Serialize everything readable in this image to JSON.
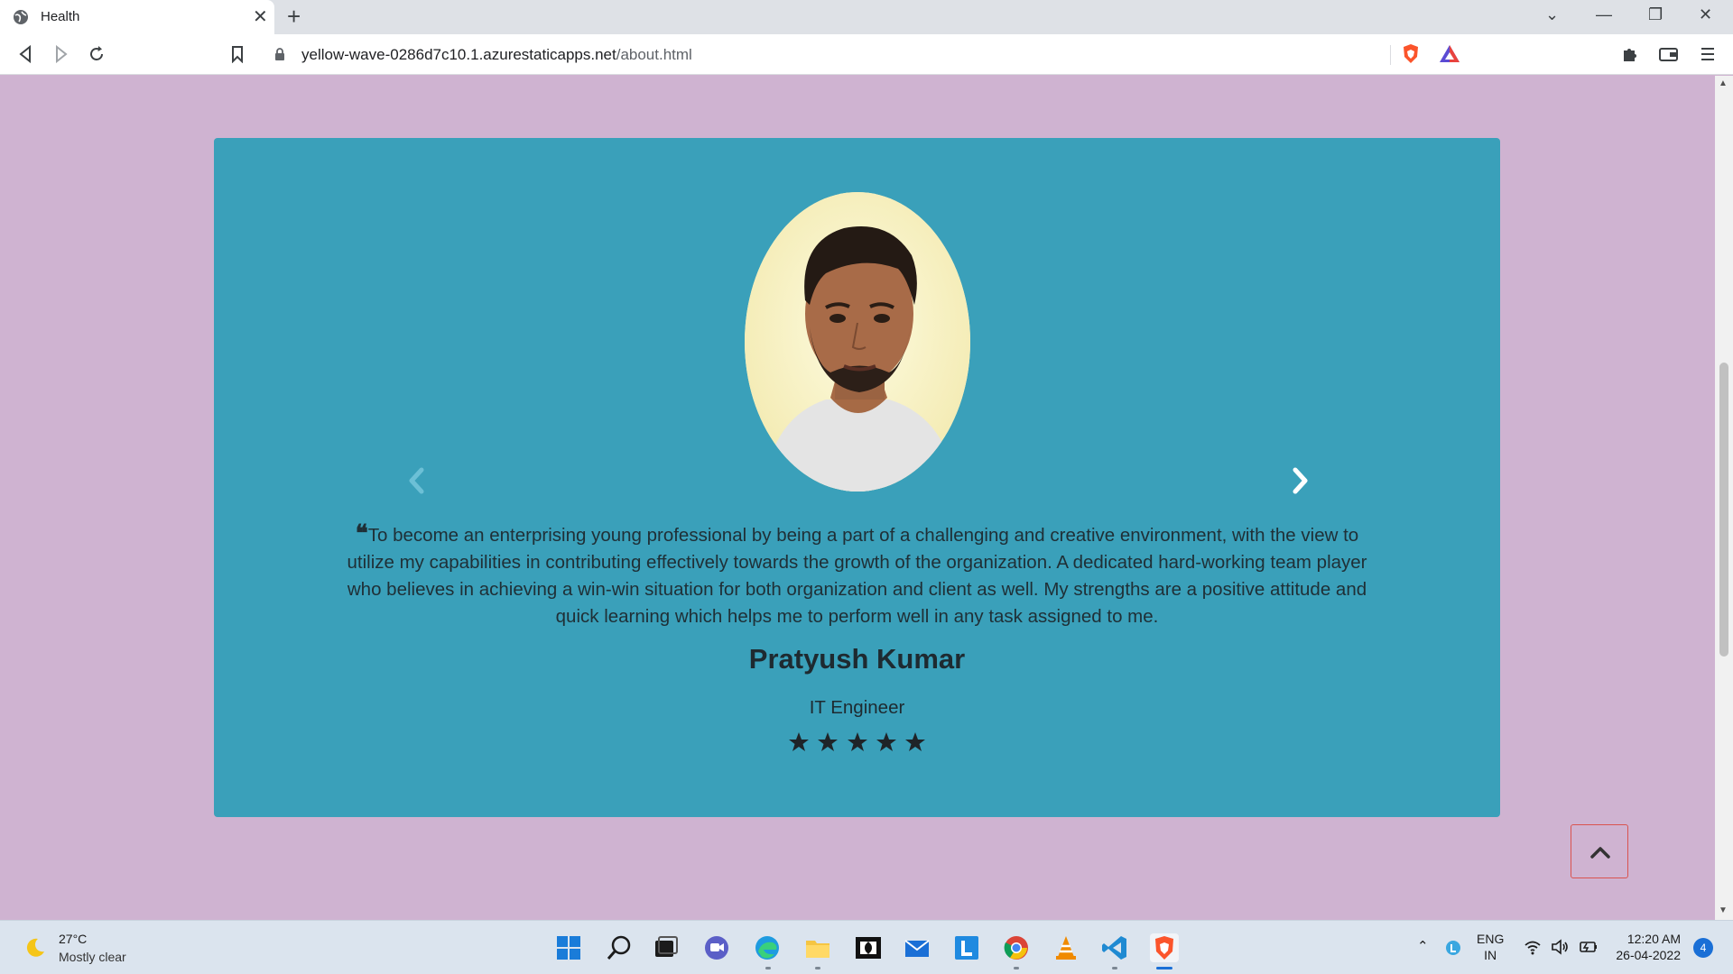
{
  "browser": {
    "tab_title": "Health",
    "url_host": "yellow-wave-0286d7c10.1.azurestaticapps.net",
    "url_path": "/about.html"
  },
  "testimonial": {
    "quote": "To become an enterprising young professional by being a part of a challenging and creative environment, with the view to utilize my capabilities in contributing effectively towards the growth of the organization. A dedicated hard-working team player who believes in achieving a win-win situation for both organization and client as well. My strengths are a positive attitude and quick learning which helps me to perform well in any task assigned to me.",
    "name": "Pratyush Kumar",
    "role": "IT Engineer",
    "rating": 5,
    "rating_max": 5,
    "colors": {
      "card": "#3aa0ba",
      "page": "#cfb3d1",
      "text": "#1e2a30"
    }
  },
  "taskbar": {
    "weather_temp": "27°C",
    "weather_desc": "Mostly clear",
    "lang_line1": "ENG",
    "lang_line2": "IN",
    "time": "12:20 AM",
    "date": "26-04-2022",
    "notification_count": "4",
    "apps": [
      "start-icon",
      "search-icon",
      "task-view-icon",
      "teams-chat-icon",
      "edge-icon",
      "file-explorer-icon",
      "dolby-icon",
      "mail-icon",
      "l-app-icon",
      "chrome-icon",
      "vlc-icon",
      "vscode-icon",
      "brave-icon"
    ]
  }
}
